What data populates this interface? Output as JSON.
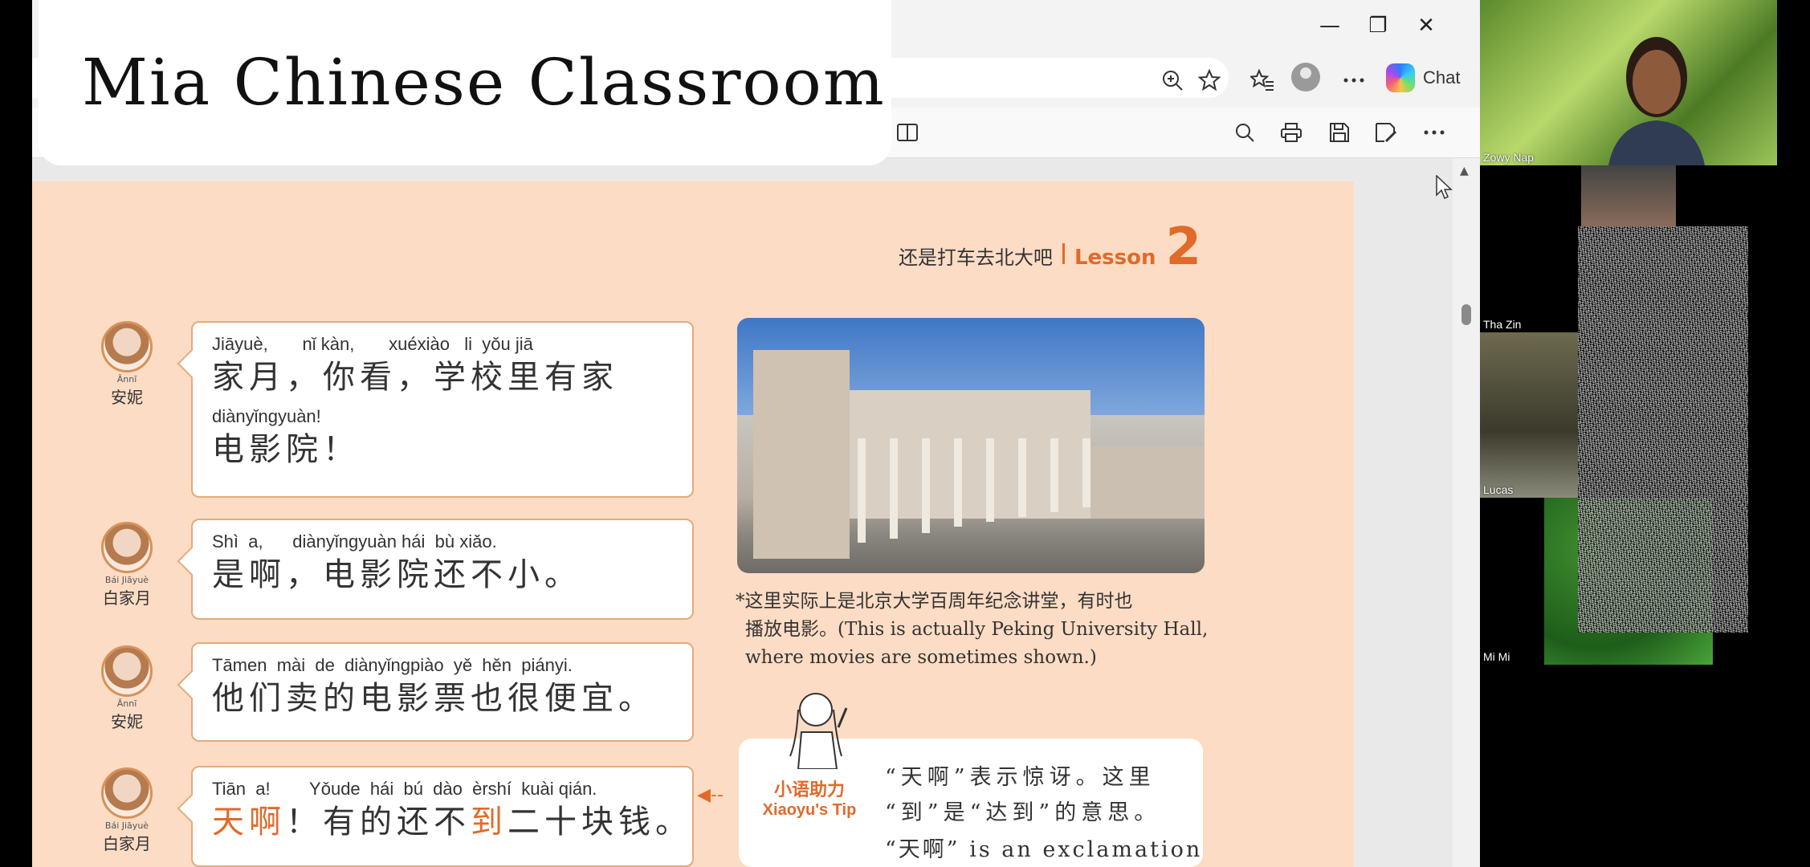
{
  "browser": {
    "window_controls": {
      "minimize": "—",
      "restore": "❐",
      "close": "✕"
    },
    "toolbar_icons": [
      "zoom-in-icon",
      "favorite-star-icon",
      "favorites-icon",
      "profile-icon",
      "more-icon"
    ],
    "chat_label": "Chat",
    "pdf_toolbar_icons": [
      "page-view-icon",
      "search-icon",
      "print-icon",
      "save-icon",
      "save-as-icon",
      "more-icon"
    ]
  },
  "banner": {
    "title": "Mia Chinese Classroom"
  },
  "lesson": {
    "title_cn": "还是打车去北大吧",
    "lesson_word": "Lesson",
    "lesson_number": "2"
  },
  "dialogue": [
    {
      "speaker_pinyin": "Ānnī",
      "speaker_cn": "安妮",
      "lines": [
        {
          "pinyin": "Jiāyuè,       nǐ kàn,       xuéxiào   li  yǒu jiā",
          "hanzi": "家月，你看，学校里有家"
        },
        {
          "pinyin": "diànyǐngyuàn!",
          "hanzi": "电影院！"
        }
      ]
    },
    {
      "speaker_pinyin": "Bái  Jiāyuè",
      "speaker_cn": "白家月",
      "lines": [
        {
          "pinyin": "Shì  a,      diànyǐngyuàn hái  bù xiǎo.",
          "hanzi": "是啊，电影院还不小。"
        }
      ]
    },
    {
      "speaker_pinyin": "Ānnī",
      "speaker_cn": "安妮",
      "lines": [
        {
          "pinyin": "Tāmen  mài  de  diànyǐngpiào  yě  hěn  piányi.",
          "hanzi": "他们卖的电影票也很便宜。"
        }
      ]
    },
    {
      "speaker_pinyin": "Bái  Jiāyuè",
      "speaker_cn": "白家月",
      "lines": [
        {
          "pinyin": "Tiān  a!        Yǒude  hái  bú  dào  èrshí  kuài qián.",
          "hanzi_parts": [
            "天啊",
            "！有的还不",
            "到",
            "二十块钱。"
          ]
        }
      ]
    }
  ],
  "photo_caption": "*这里实际上是北京大学百周年纪念讲堂，有时也播放电影。(This is actually Peking University Hall, where movies are sometimes shown.)",
  "caption_lines": [
    "*这里实际上是北京大学百周年纪念讲堂，有时也",
    "播放电影。(This is actually Peking University Hall,",
    "where movies are sometimes shown.)"
  ],
  "tip": {
    "label_cn": "小语助力",
    "label_en": "Xiaoyu's Tip",
    "lines": [
      "“天啊”表示惊讶。这里",
      "“到”是“达到”的意思。",
      "“天啊” is an exclamation"
    ]
  },
  "participants": [
    {
      "name": "Zowy Nap"
    },
    {
      "name": "Tha Zin"
    },
    {
      "name": "Lucas"
    },
    {
      "name": "Mi Mi"
    }
  ]
}
